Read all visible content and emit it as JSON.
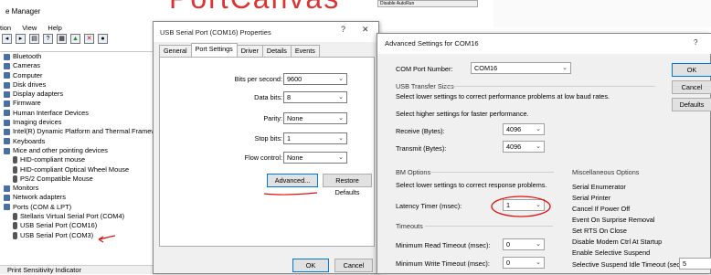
{
  "colors": {
    "accent": "#0078d7",
    "ink_red": "#e01010",
    "dialog_bg": "#f0f0f0"
  },
  "device_manager": {
    "title": "e Manager",
    "menu": [
      "tion",
      "View",
      "Help"
    ],
    "toolbar_icons": [
      "back-icon",
      "forward-icon",
      "properties-icon",
      "help-icon",
      "scan-icon",
      "update-driver-icon",
      "uninstall-icon",
      "disable-icon"
    ],
    "tree": [
      {
        "label": "Bluetooth",
        "level": 1
      },
      {
        "label": "Cameras",
        "level": 1
      },
      {
        "label": "Computer",
        "level": 1
      },
      {
        "label": "Disk drives",
        "level": 1
      },
      {
        "label": "Display adapters",
        "level": 1
      },
      {
        "label": "Firmware",
        "level": 1
      },
      {
        "label": "Human Interface Devices",
        "level": 1
      },
      {
        "label": "Imaging devices",
        "level": 1
      },
      {
        "label": "Intel(R) Dynamic Platform and Thermal Framework",
        "level": 1
      },
      {
        "label": "Keyboards",
        "level": 1
      },
      {
        "label": "Mice and other pointing devices",
        "level": 1
      },
      {
        "label": "HID-compliant mouse",
        "level": 2
      },
      {
        "label": "HID-compliant Optical Wheel Mouse",
        "level": 2
      },
      {
        "label": "PS/2 Compatible Mouse",
        "level": 2
      },
      {
        "label": "Monitors",
        "level": 1
      },
      {
        "label": "Network adapters",
        "level": 1
      },
      {
        "label": "Ports (COM & LPT)",
        "level": 1
      },
      {
        "label": "Stellaris Virtual Serial Port (COM4)",
        "level": 2
      },
      {
        "label": "USB Serial Port (COM16)",
        "level": 2
      },
      {
        "label": "USB Serial Port (COM3)",
        "level": 2
      }
    ],
    "status": "Print Sensitivity Indicator"
  },
  "background": {
    "red_text": "PortCanvas",
    "strip_text": "Disable AutoRun"
  },
  "properties_dialog": {
    "title": "USB Serial Port (COM16) Properties",
    "help": "?",
    "close": "✕",
    "tabs": [
      "General",
      "Port Settings",
      "Driver",
      "Details",
      "Events"
    ],
    "fields": [
      {
        "label": "Bits per second:",
        "value": "9600"
      },
      {
        "label": "Data bits:",
        "value": "8"
      },
      {
        "label": "Parity:",
        "value": "None"
      },
      {
        "label": "Stop bits:",
        "value": "1"
      },
      {
        "label": "Flow control:",
        "value": "None"
      }
    ],
    "advanced_button": "Advanced...",
    "restore_button": "Restore Defaults",
    "ok_button": "OK",
    "cancel_button": "Cancel"
  },
  "advanced_dialog": {
    "title": "Advanced Settings for COM16",
    "help": "?",
    "com_port_label": "COM Port Number:",
    "com_port_value": "COM16",
    "usb_transfer": {
      "title": "USB Transfer Sizes",
      "hint_low": "Select lower settings to correct performance problems at low baud rates.",
      "hint_high": "Select higher settings for faster performance.",
      "receive_label": "Receive (Bytes):",
      "receive_value": "4096",
      "transmit_label": "Transmit (Bytes):",
      "transmit_value": "4096"
    },
    "bm_options": {
      "title": "BM Options",
      "hint": "Select lower settings to correct response problems.",
      "latency_label": "Latency Timer (msec):",
      "latency_value": "1"
    },
    "timeouts": {
      "title": "Timeouts",
      "read_label": "Minimum Read Timeout (msec):",
      "read_value": "0",
      "write_label": "Minimum Write Timeout (msec):",
      "write_value": "0"
    },
    "misc": {
      "title": "Miscellaneous Options",
      "items": [
        "Serial Enumerator",
        "Serial Printer",
        "Cancel If Power Off",
        "Event On Surprise Removal",
        "Set RTS On Close",
        "Disable Modem Ctrl At Startup",
        "Enable Selective Suspend"
      ],
      "idle_label": "Selective Suspend Idle Timeout (secs):",
      "idle_value": "5"
    },
    "ok_button": "OK",
    "cancel_button": "Cancel",
    "defaults_button": "Defaults"
  }
}
